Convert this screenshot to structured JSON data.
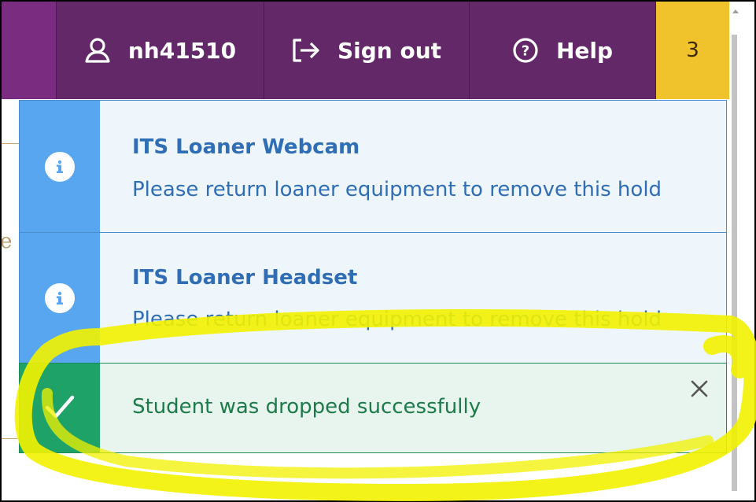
{
  "header": {
    "username": "nh41510",
    "sign_out_label": "Sign out",
    "help_label": "Help",
    "notification_count": "3"
  },
  "notifications": [
    {
      "type": "info",
      "icon": "info-icon",
      "title": "ITS Loaner Webcam",
      "message": "Please return loaner equipment to remove this hold"
    },
    {
      "type": "info",
      "icon": "info-icon",
      "title": "ITS Loaner Headset",
      "message": "Please return loaner equipment to remove this hold"
    },
    {
      "type": "success",
      "icon": "checkmark-icon",
      "message": "Student was dropped successfully",
      "close_icon": "close-icon"
    }
  ],
  "colors": {
    "nav_bg": "#632868",
    "count_badge": "#f0c22c",
    "info_accent": "#58a6f0",
    "success_accent": "#1ea268",
    "highlight": "#f4f000"
  }
}
